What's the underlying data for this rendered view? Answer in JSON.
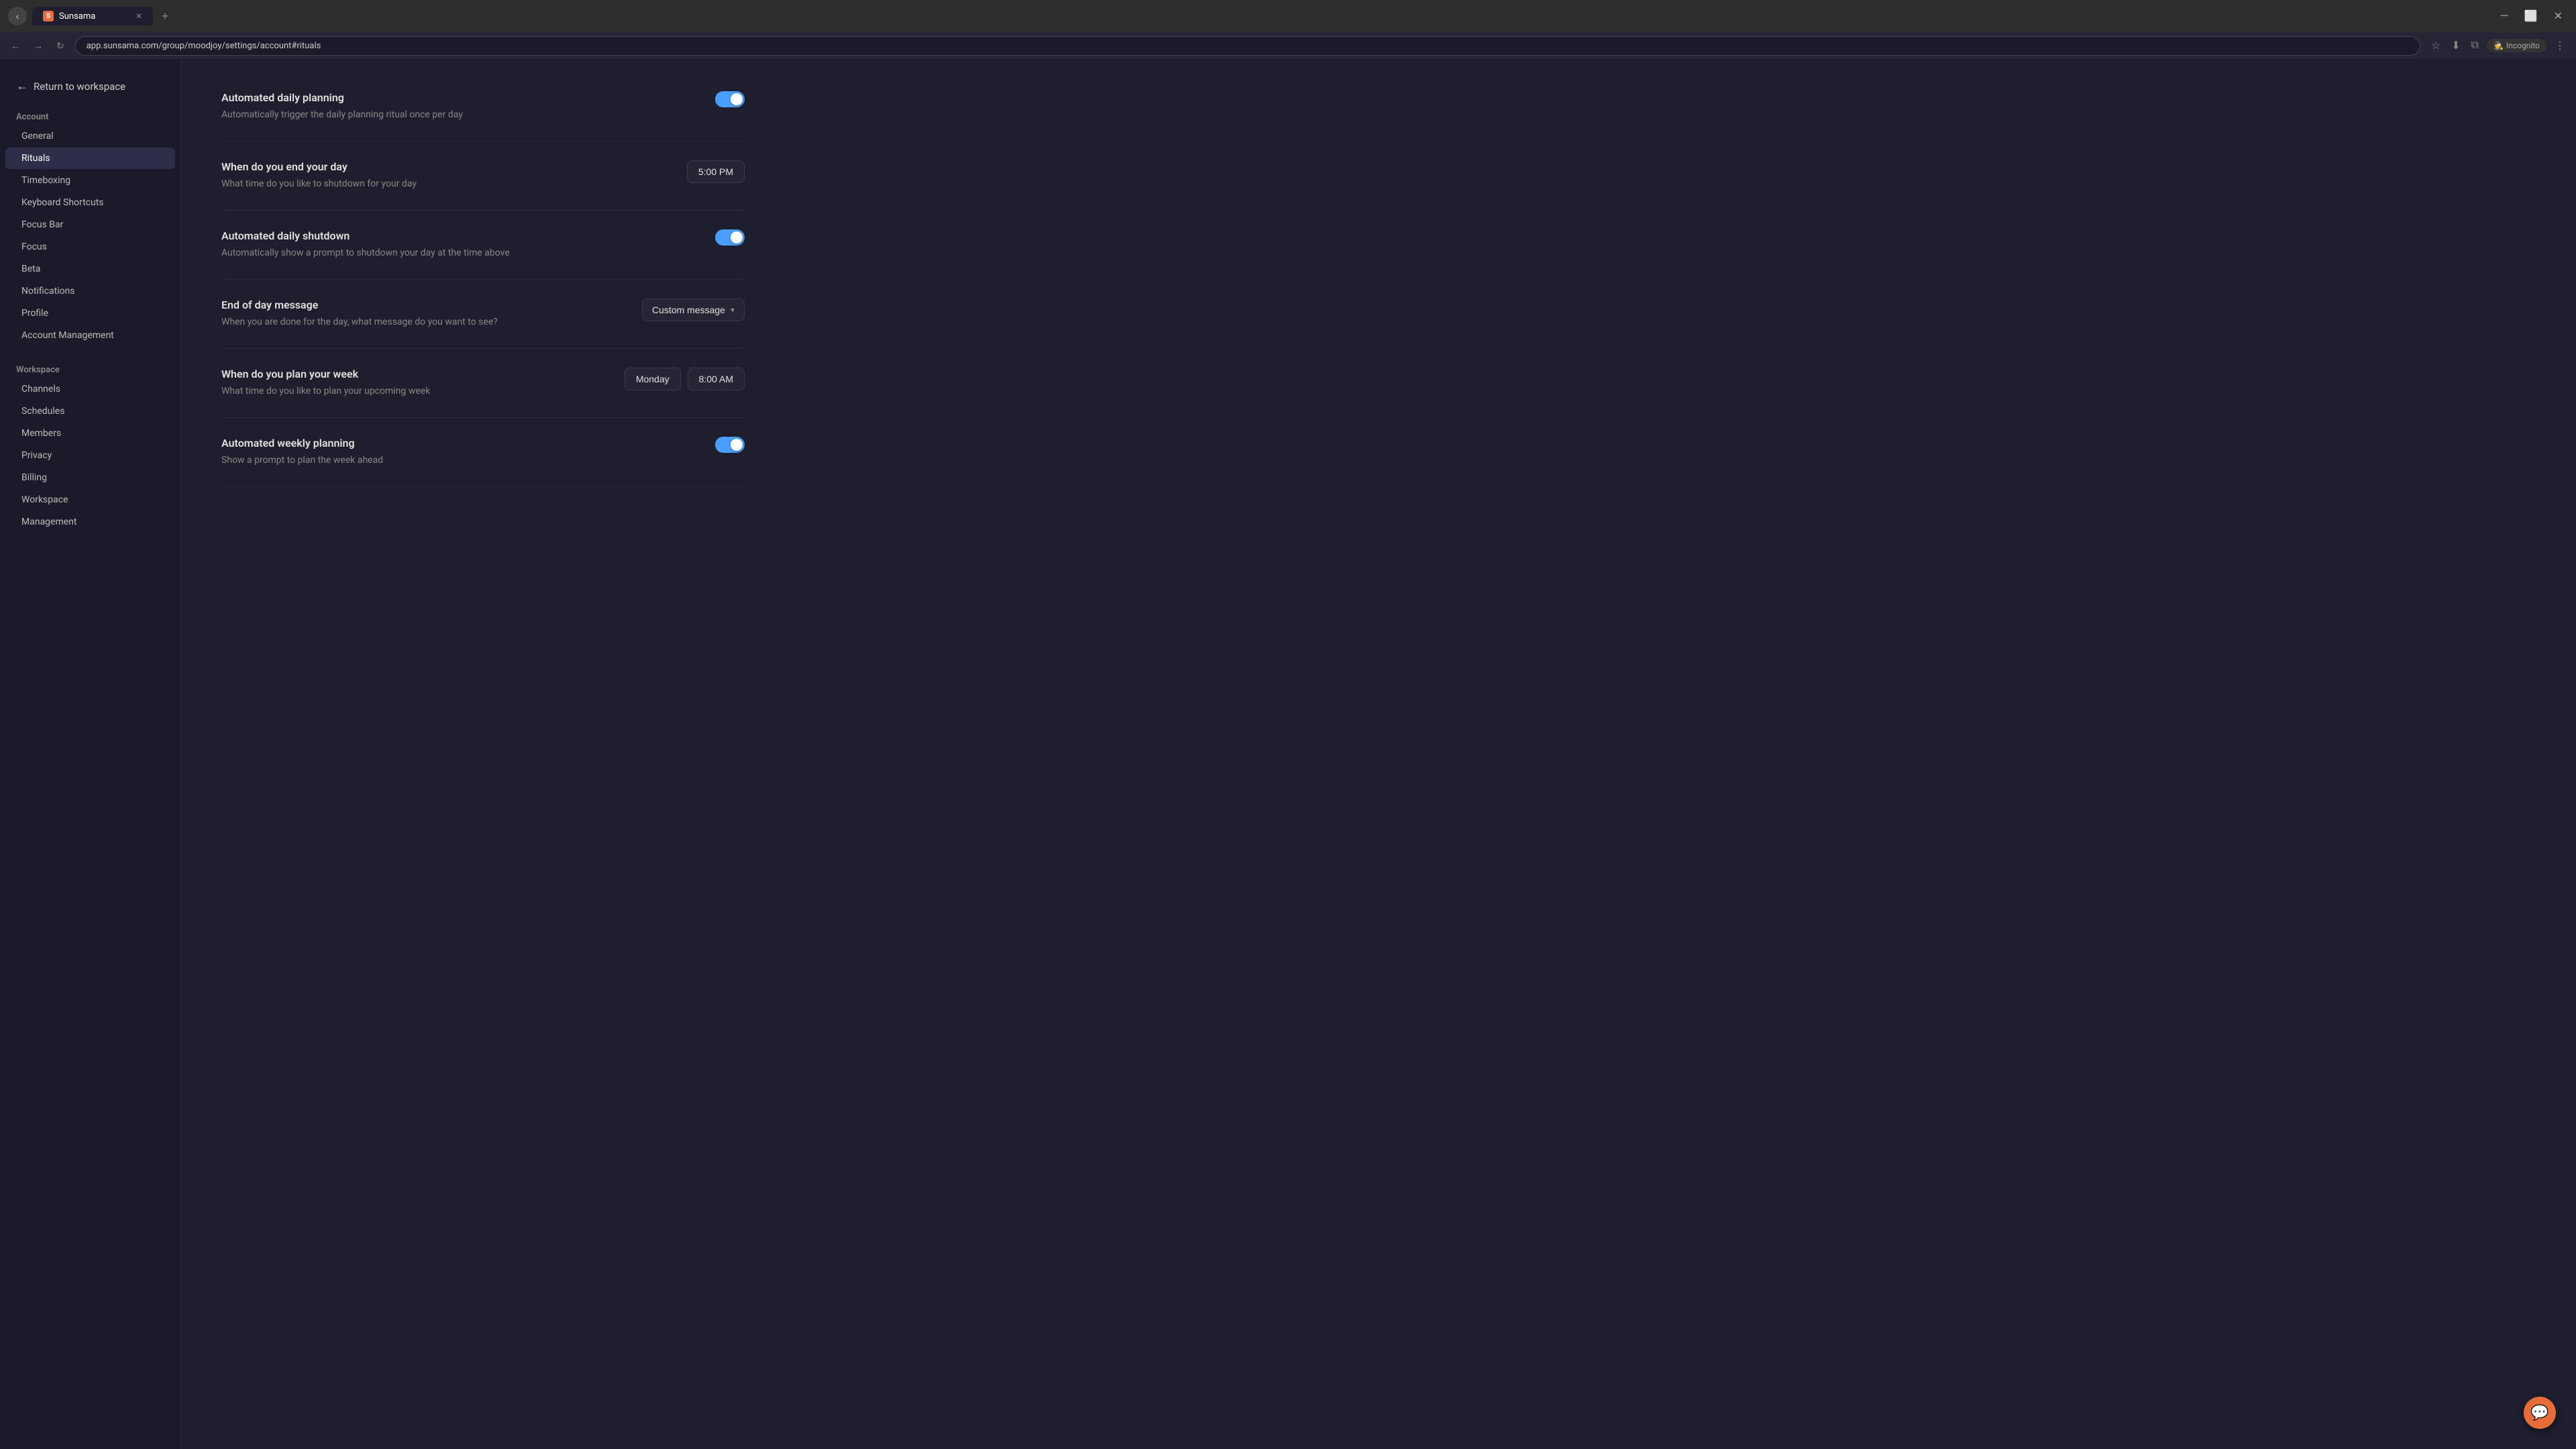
{
  "browser": {
    "tab_label": "Sunsama",
    "tab_favicon": "S",
    "url": "app.sunsama.com/group/moodjoy/settings/account#rituals",
    "incognito_label": "Incognito",
    "nav_back": "←",
    "nav_forward": "→",
    "nav_refresh": "↻"
  },
  "sidebar": {
    "return_label": "Return to workspace",
    "account_section": "Account",
    "account_items": [
      {
        "label": "General",
        "active": false
      },
      {
        "label": "Rituals",
        "active": true
      },
      {
        "label": "Timeboxing",
        "active": false
      },
      {
        "label": "Keyboard Shortcuts",
        "active": false
      },
      {
        "label": "Focus Bar",
        "active": false
      },
      {
        "label": "Focus",
        "active": false
      },
      {
        "label": "Beta",
        "active": false
      },
      {
        "label": "Notifications",
        "active": false
      },
      {
        "label": "Profile",
        "active": false
      },
      {
        "label": "Account Management",
        "active": false
      }
    ],
    "workspace_section": "Workspace",
    "workspace_items": [
      {
        "label": "Channels",
        "active": false
      },
      {
        "label": "Schedules",
        "active": false
      },
      {
        "label": "Members",
        "active": false
      },
      {
        "label": "Privacy",
        "active": false
      },
      {
        "label": "Billing",
        "active": false
      },
      {
        "label": "Workspace",
        "active": false
      },
      {
        "label": "Management",
        "active": false
      }
    ]
  },
  "settings": [
    {
      "id": "automated_daily_planning",
      "title": "Automated daily planning",
      "desc": "Automatically trigger the daily planning ritual once per day",
      "control_type": "toggle",
      "toggle_on": true
    },
    {
      "id": "end_of_day",
      "title": "When do you end your day",
      "desc": "What time do you like to shutdown for your day",
      "control_type": "time",
      "time_value": "5:00 PM"
    },
    {
      "id": "automated_daily_shutdown",
      "title": "Automated daily shutdown",
      "desc": "Automatically show a prompt to shutdown your day at the time above",
      "control_type": "toggle",
      "toggle_on": true
    },
    {
      "id": "end_of_day_message",
      "title": "End of day message",
      "desc": "When you are done for the day, what message do you want to see?",
      "control_type": "dropdown",
      "dropdown_value": "Custom message"
    },
    {
      "id": "plan_your_week",
      "title": "When do you plan your week",
      "desc": "What time do you like to plan your upcoming week",
      "control_type": "time_day",
      "day_value": "Monday",
      "time_value": "8:00 AM"
    },
    {
      "id": "automated_weekly_planning",
      "title": "Automated weekly planning",
      "desc": "Show a prompt to plan the week ahead",
      "control_type": "toggle",
      "toggle_on": true
    }
  ]
}
